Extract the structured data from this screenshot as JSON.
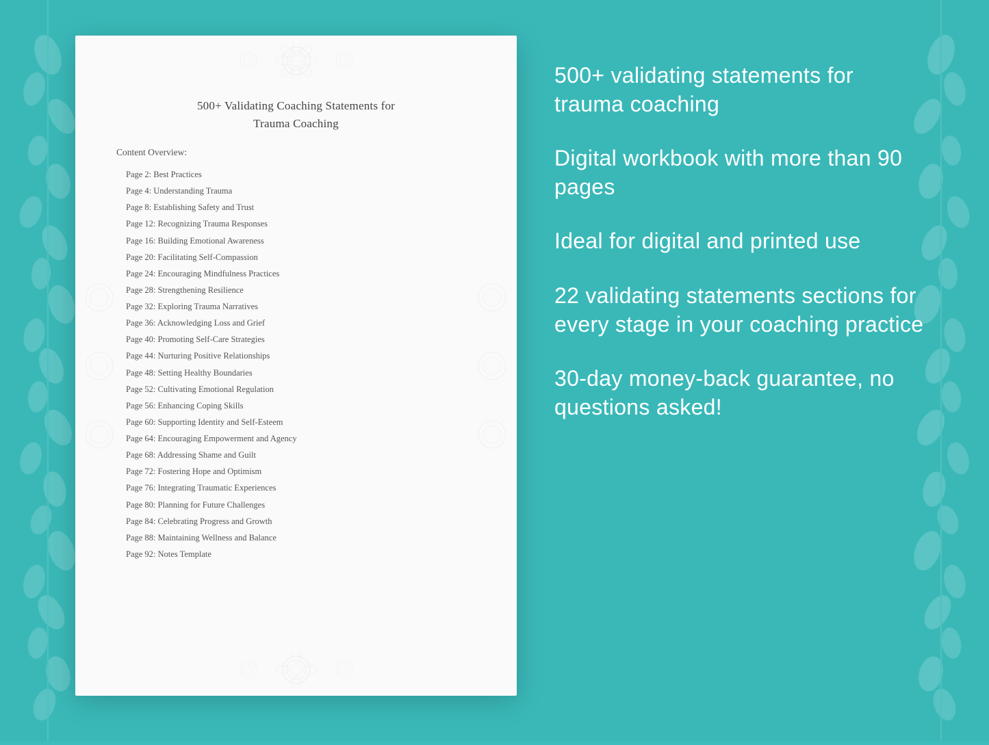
{
  "background": {
    "color": "#3ab8b8"
  },
  "document": {
    "title_line1": "500+ Validating Coaching Statements for",
    "title_line2": "Trauma Coaching",
    "content_label": "Content Overview:",
    "toc": [
      {
        "page": "Page  2:",
        "topic": "Best Practices"
      },
      {
        "page": "Page  4:",
        "topic": "Understanding Trauma"
      },
      {
        "page": "Page  8:",
        "topic": "Establishing Safety and Trust"
      },
      {
        "page": "Page 12:",
        "topic": "Recognizing Trauma Responses"
      },
      {
        "page": "Page 16:",
        "topic": "Building Emotional Awareness"
      },
      {
        "page": "Page 20:",
        "topic": "Facilitating Self-Compassion"
      },
      {
        "page": "Page 24:",
        "topic": "Encouraging Mindfulness Practices"
      },
      {
        "page": "Page 28:",
        "topic": "Strengthening Resilience"
      },
      {
        "page": "Page 32:",
        "topic": "Exploring Trauma Narratives"
      },
      {
        "page": "Page 36:",
        "topic": "Acknowledging Loss and Grief"
      },
      {
        "page": "Page 40:",
        "topic": "Promoting Self-Care Strategies"
      },
      {
        "page": "Page 44:",
        "topic": "Nurturing Positive Relationships"
      },
      {
        "page": "Page 48:",
        "topic": "Setting Healthy Boundaries"
      },
      {
        "page": "Page 52:",
        "topic": "Cultivating Emotional Regulation"
      },
      {
        "page": "Page 56:",
        "topic": "Enhancing Coping Skills"
      },
      {
        "page": "Page 60:",
        "topic": "Supporting Identity and Self-Esteem"
      },
      {
        "page": "Page 64:",
        "topic": "Encouraging Empowerment and Agency"
      },
      {
        "page": "Page 68:",
        "topic": "Addressing Shame and Guilt"
      },
      {
        "page": "Page 72:",
        "topic": "Fostering Hope and Optimism"
      },
      {
        "page": "Page 76:",
        "topic": "Integrating Traumatic Experiences"
      },
      {
        "page": "Page 80:",
        "topic": "Planning for Future Challenges"
      },
      {
        "page": "Page 84:",
        "topic": "Celebrating Progress and Growth"
      },
      {
        "page": "Page 88:",
        "topic": "Maintaining Wellness and Balance"
      },
      {
        "page": "Page 92:",
        "topic": "Notes Template"
      }
    ]
  },
  "info_panel": {
    "blocks": [
      {
        "text": "500+ validating statements for trauma coaching"
      },
      {
        "text": "Digital workbook with more than 90 pages"
      },
      {
        "text": "Ideal for digital and printed use"
      },
      {
        "text": "22 validating statements sections for every stage in your coaching practice"
      },
      {
        "text": "30-day money-back guarantee, no questions asked!"
      }
    ]
  }
}
